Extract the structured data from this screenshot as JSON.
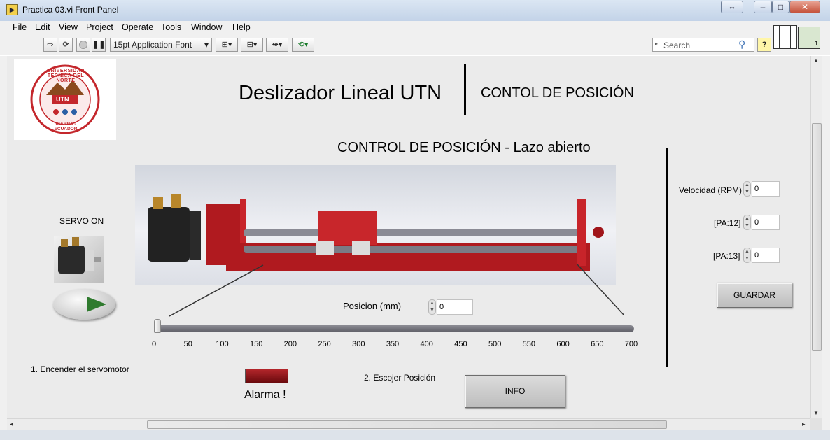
{
  "window": {
    "title": "Practica 03.vi Front Panel",
    "app_icon_glyph": "▶"
  },
  "menu": [
    "File",
    "Edit",
    "View",
    "Project",
    "Operate",
    "Tools",
    "Window",
    "Help"
  ],
  "toolbar": {
    "font_label": "15pt Application Font",
    "search_placeholder": "Search"
  },
  "header": {
    "title": "Deslizador Lineal UTN",
    "subtitle": "CONTOL DE POSICIÓN",
    "logo": {
      "ring_text": "UNIVERSIDAD TECNICA DEL NORTE",
      "bottom_text": "IBARRA - ECUADOR",
      "center_text": "UTN"
    }
  },
  "section_title": "CONTROL DE POSICIÓN - Lazo abierto",
  "servo": {
    "label": "SERVO ON",
    "step_label": "1. Encender el servomotor"
  },
  "position": {
    "label": "Posicion (mm)",
    "value": "0",
    "slider_value": 0,
    "slider_max": 700,
    "ticks": [
      "0",
      "50",
      "100",
      "150",
      "200",
      "250",
      "300",
      "350",
      "400",
      "450",
      "500",
      "550",
      "600",
      "650",
      "700"
    ],
    "step_label": "2. Escojer Posición"
  },
  "alarm": {
    "label": "Alarma !"
  },
  "info_button": "INFO",
  "params": {
    "velocidad_label": "Velocidad (RPM)",
    "velocidad_value": "0",
    "pa12_label": "[PA:12]",
    "pa12_value": "0",
    "pa13_label": "[PA:13]",
    "pa13_value": "0",
    "save_button": "GUARDAR"
  },
  "colors": {
    "panel": "#ebebeb",
    "slider_red": "#b31a1f",
    "alarm": "#7a0d10"
  }
}
